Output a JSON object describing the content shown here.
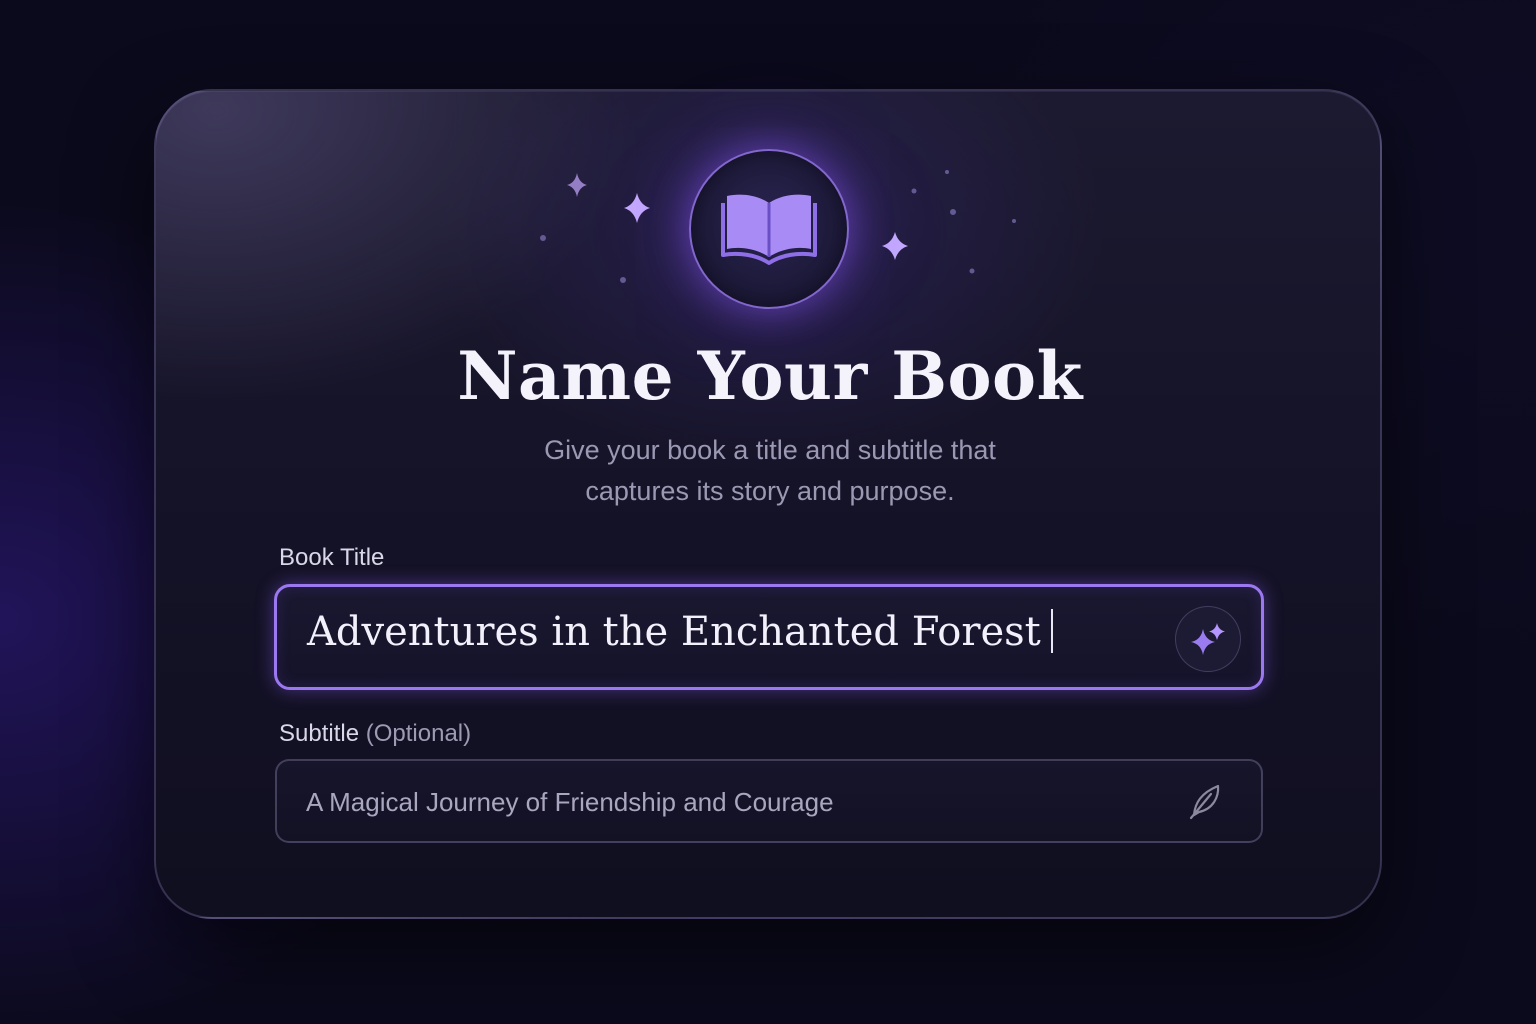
{
  "dialog": {
    "title": "Name Your Book",
    "description_line1": "Give your book a title and subtitle that",
    "description_line2": "captures its story and purpose."
  },
  "fields": {
    "book_title": {
      "label": "Book Title",
      "value": "Adventures in the Enchanted Forest"
    },
    "subtitle": {
      "label": "Subtitle",
      "optional_note": "(Optional)",
      "placeholder": "A Magical Journey of Friendship and Courage"
    }
  },
  "icons": {
    "badge": "open-book-icon",
    "title_action": "sparkles-icon",
    "subtitle_action": "feather-icon",
    "decor": "sparkle-icon"
  },
  "colors": {
    "accent": "#9c78f0",
    "icon_fill": "#a98bf5",
    "background": "#0b0a1c",
    "card": "#15132a",
    "title_text": "#f4f2fb",
    "muted_text": "#9b98b4"
  }
}
